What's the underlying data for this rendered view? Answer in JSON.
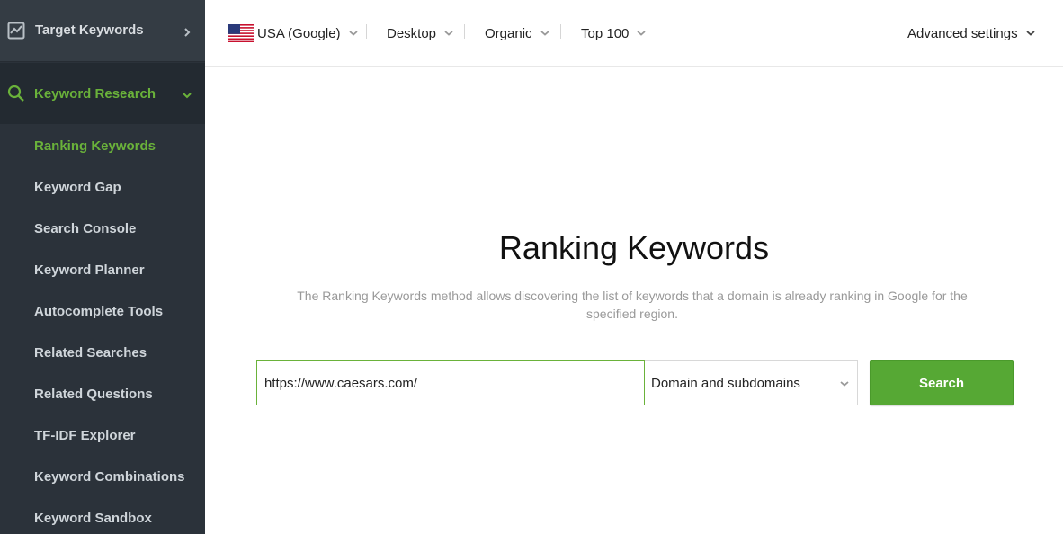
{
  "sidebar": {
    "top_item": {
      "label": "Target Keywords",
      "icon": "chart-line-icon"
    },
    "section": {
      "label": "Keyword Research",
      "icon": "search-icon"
    },
    "items": [
      {
        "label": "Ranking Keywords",
        "active": true
      },
      {
        "label": "Keyword Gap"
      },
      {
        "label": "Search Console"
      },
      {
        "label": "Keyword Planner"
      },
      {
        "label": "Autocomplete Tools"
      },
      {
        "label": "Related Searches"
      },
      {
        "label": "Related Questions"
      },
      {
        "label": "TF-IDF Explorer"
      },
      {
        "label": "Keyword Combinations"
      },
      {
        "label": "Keyword Sandbox"
      }
    ]
  },
  "topbar": {
    "country": "USA (Google)",
    "device": "Desktop",
    "type": "Organic",
    "depth": "Top 100",
    "advanced": "Advanced settings"
  },
  "main": {
    "title": "Ranking Keywords",
    "description": "The Ranking Keywords method allows discovering the list of keywords that a domain is already ranking in Google for the specified region.",
    "url_value": "https://www.caesars.com/",
    "scope_selected": "Domain and subdomains",
    "search_label": "Search"
  },
  "colors": {
    "accent_green": "#6ab23a",
    "button_green": "#56a834",
    "sidebar_bg": "#2b323a"
  }
}
